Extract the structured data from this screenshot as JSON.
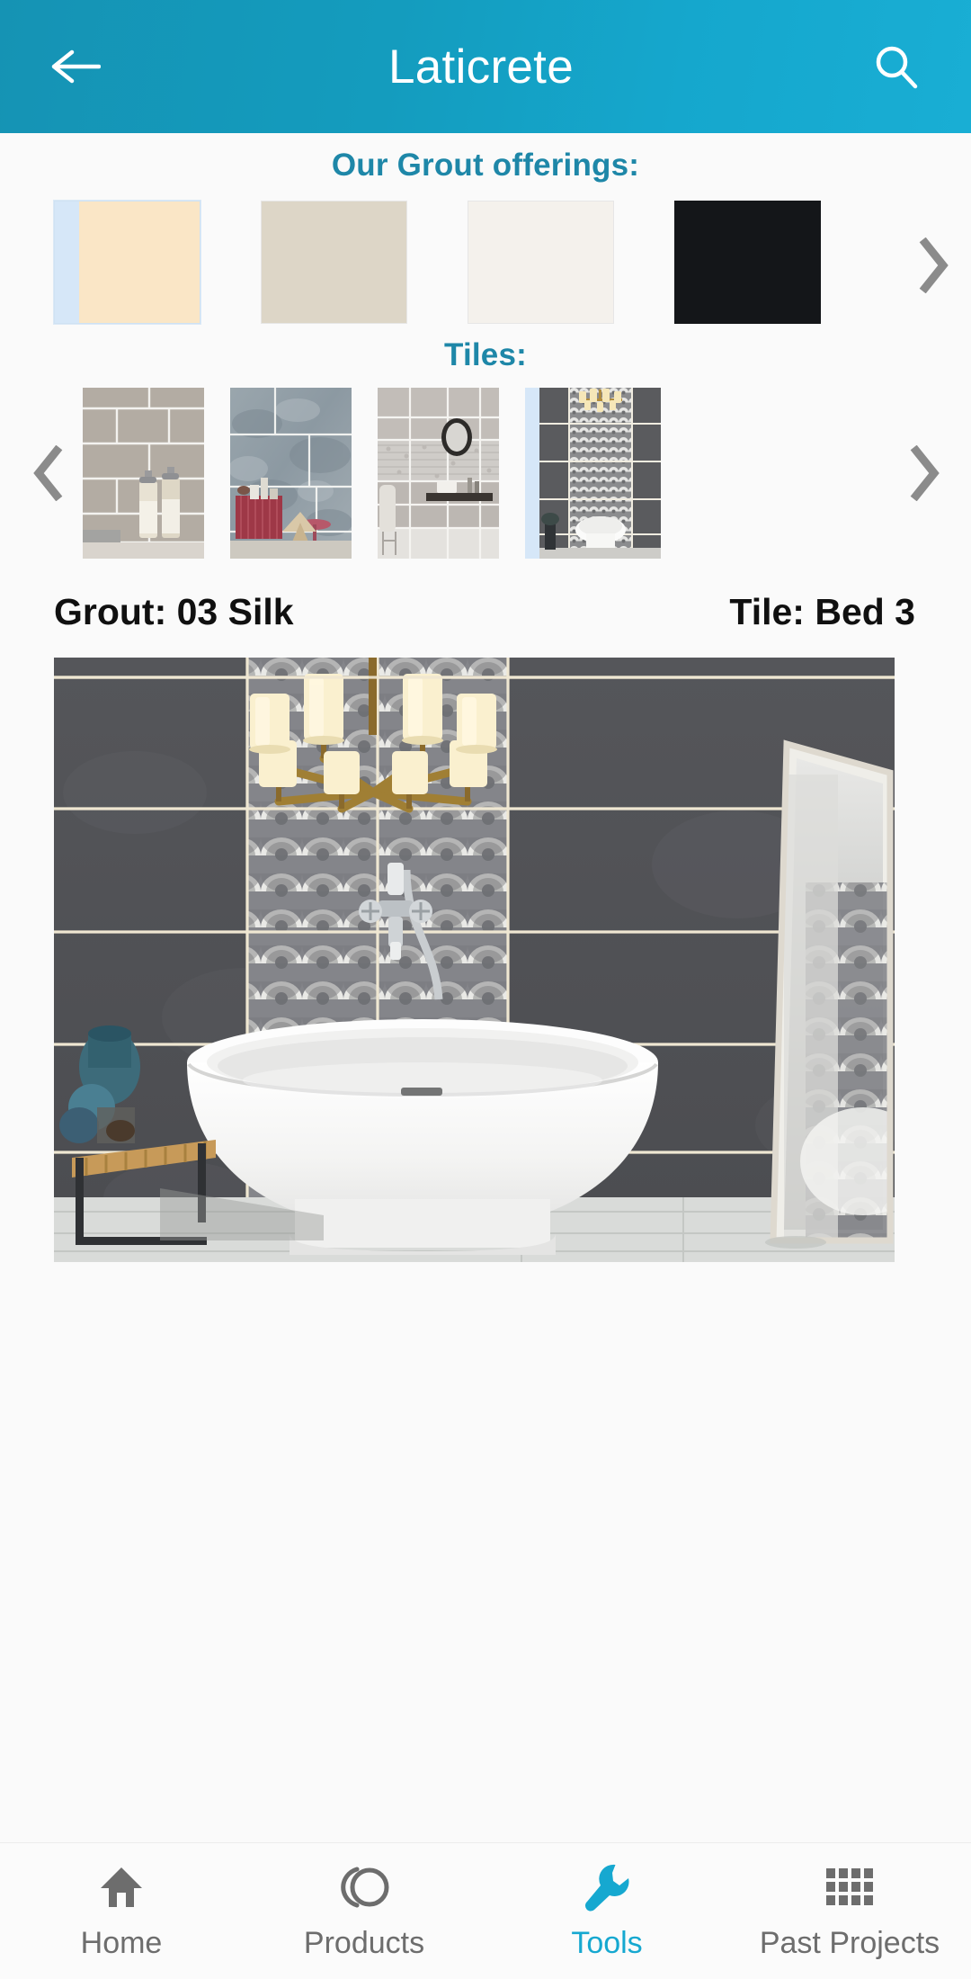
{
  "appbar": {
    "title": "Laticrete",
    "back_icon": "arrow-left-icon",
    "search_icon": "search-icon",
    "gradient_start": "#1593b4",
    "gradient_end": "#19aed4"
  },
  "grout_section": {
    "heading": "Our Grout offerings:",
    "heading_color": "#1e87a8",
    "next_arrow_icon": "chevron-right-icon",
    "swatches": [
      {
        "name": "grout-swatch-cream",
        "color": "#fae6c6",
        "selected": true
      },
      {
        "name": "grout-swatch-taupe",
        "color": "#ddd6c7",
        "selected": false
      },
      {
        "name": "grout-swatch-white",
        "color": "#f4f1ec",
        "selected": false
      },
      {
        "name": "grout-swatch-black",
        "color": "#141619",
        "selected": false
      }
    ]
  },
  "tiles_section": {
    "heading": "Tiles:",
    "heading_color": "#1e87a8",
    "prev_arrow_icon": "chevron-left-icon",
    "next_arrow_icon": "chevron-right-icon",
    "thumbs": [
      {
        "name": "tile-thumb-1",
        "selected": false
      },
      {
        "name": "tile-thumb-2",
        "selected": false
      },
      {
        "name": "tile-thumb-3",
        "selected": false
      },
      {
        "name": "tile-thumb-4",
        "selected": true
      }
    ]
  },
  "selection": {
    "grout_label": "Grout: 03 Silk",
    "tile_label": "Tile: Bed 3"
  },
  "preview": {
    "alt": "Bathroom render with dark grey wall tile, patterned feature column, gold chandelier, freestanding white bathtub and leaning mirror",
    "grout_line_color": "#efe7d2",
    "wall_tile_color": "#55565a"
  },
  "bottomnav": {
    "active_color": "#16a8d0",
    "inactive_color": "#6d6d6d",
    "items": [
      {
        "label": "Home",
        "icon": "home-icon",
        "active": false
      },
      {
        "label": "Products",
        "icon": "bucket-icon",
        "active": false
      },
      {
        "label": "Tools",
        "icon": "wrench-icon",
        "active": true
      },
      {
        "label": "Past Projects",
        "icon": "grid-icon",
        "active": false
      }
    ]
  }
}
